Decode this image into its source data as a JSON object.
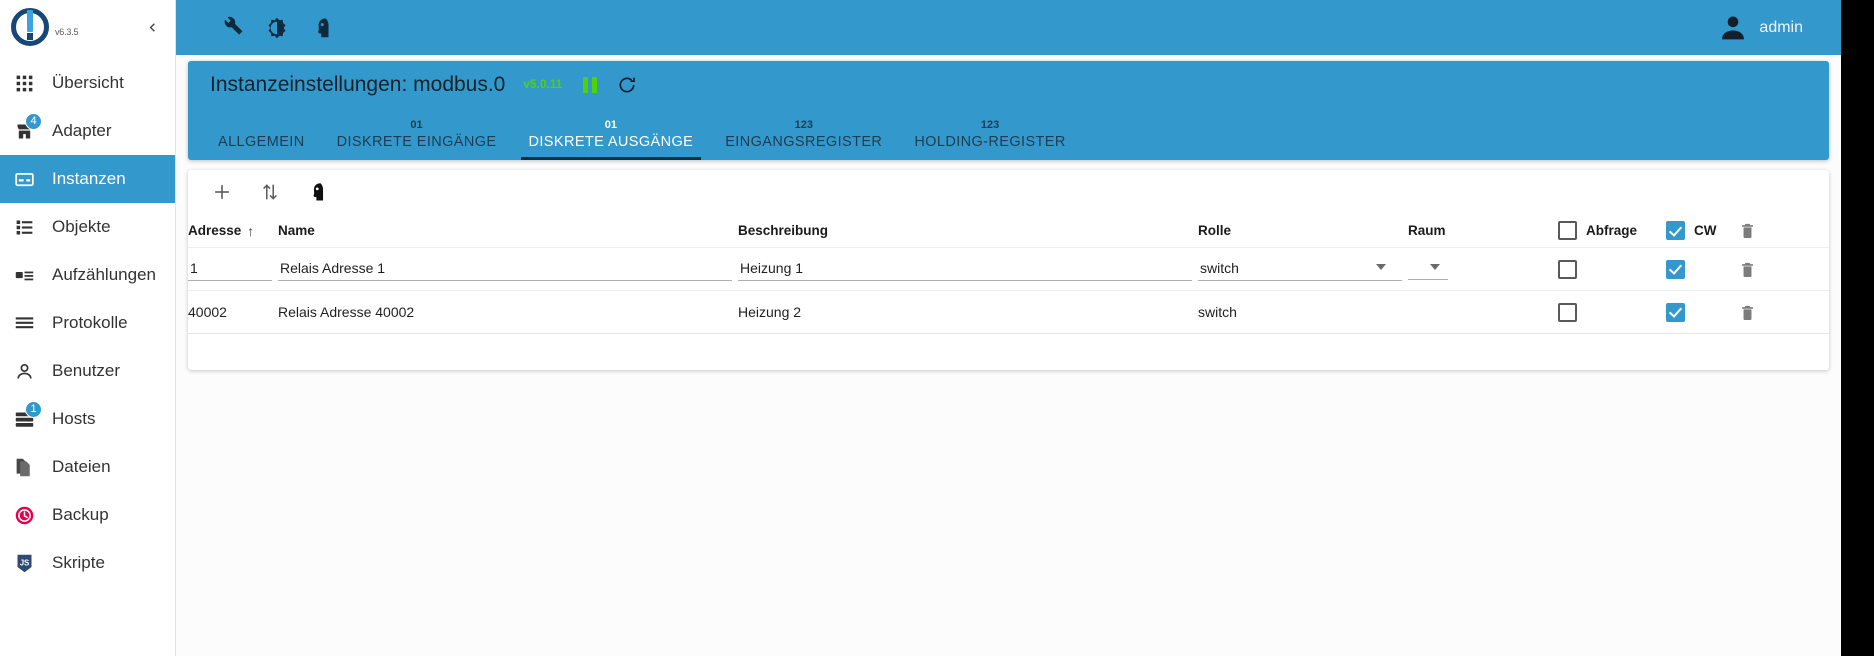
{
  "app": {
    "version": "v6.3.5",
    "logo_name": "iobroker-logo"
  },
  "sidebar": {
    "collapse_icon": "chevron-left-icon",
    "items": [
      {
        "label": "Übersicht",
        "icon": "grid-icon",
        "badge": null,
        "active": false
      },
      {
        "label": "Adapter",
        "icon": "store-icon",
        "badge": "4",
        "active": false
      },
      {
        "label": "Instanzen",
        "icon": "instance-icon",
        "badge": null,
        "active": true
      },
      {
        "label": "Objekte",
        "icon": "list-icon",
        "badge": null,
        "active": false
      },
      {
        "label": "Aufzählungen",
        "icon": "enum-icon",
        "badge": null,
        "active": false
      },
      {
        "label": "Protokolle",
        "icon": "log-icon",
        "badge": null,
        "active": false
      },
      {
        "label": "Benutzer",
        "icon": "user-icon",
        "badge": null,
        "active": false
      },
      {
        "label": "Hosts",
        "icon": "server-icon",
        "badge": "1",
        "active": false
      },
      {
        "label": "Dateien",
        "icon": "files-icon",
        "badge": null,
        "active": false
      },
      {
        "label": "Backup",
        "icon": "backup-icon",
        "badge": null,
        "active": false
      },
      {
        "label": "Skripte",
        "icon": "js-icon",
        "badge": null,
        "active": false
      }
    ]
  },
  "topbar": {
    "icons": [
      {
        "name": "wrench-icon"
      },
      {
        "name": "brightness-icon"
      },
      {
        "name": "head-profile-icon"
      }
    ],
    "user": "admin",
    "avatar_icon": "account-circle-icon",
    "bg_color": "#3399cc"
  },
  "instance": {
    "title": "Instanzeinstellungen: modbus.0",
    "version": "v5.0.11",
    "version_color": "#4fd400",
    "pause_icon": "pause-icon",
    "refresh_icon": "refresh-icon",
    "tabs": [
      {
        "sub": "",
        "label": "ALLGEMEIN",
        "selected": false
      },
      {
        "sub": "01",
        "label": "DISKRETE EINGÄNGE",
        "selected": false
      },
      {
        "sub": "01",
        "label": "DISKRETE AUSGÄNGE",
        "selected": true
      },
      {
        "sub": "123",
        "label": "EINGANGSREGISTER",
        "selected": false
      },
      {
        "sub": "123",
        "label": "HOLDING-REGISTER",
        "selected": false
      }
    ]
  },
  "table": {
    "toolbar": [
      {
        "name": "add-icon"
      },
      {
        "name": "import-export-icon"
      },
      {
        "name": "head-profile-icon"
      }
    ],
    "headers": {
      "address": "Adresse",
      "address_sort": "↑",
      "name": "Name",
      "description": "Beschreibung",
      "role": "Rolle",
      "room": "Raum",
      "poll": "Abfrage",
      "cw": "CW"
    },
    "header_poll_checked": false,
    "header_cw_checked": true,
    "header_delete_icon": "trash-icon",
    "rows": [
      {
        "address": "1",
        "name": "Relais Adresse 1",
        "description": "Heizung 1",
        "role": "switch",
        "room": "",
        "poll": false,
        "cw": true,
        "editable": true,
        "delete_icon": "trash-icon"
      },
      {
        "address": "40002",
        "name": "Relais Adresse 40002",
        "description": "Heizung 2",
        "role": "switch",
        "room": "",
        "poll": false,
        "cw": true,
        "editable": false,
        "delete_icon": "trash-icon"
      }
    ]
  }
}
